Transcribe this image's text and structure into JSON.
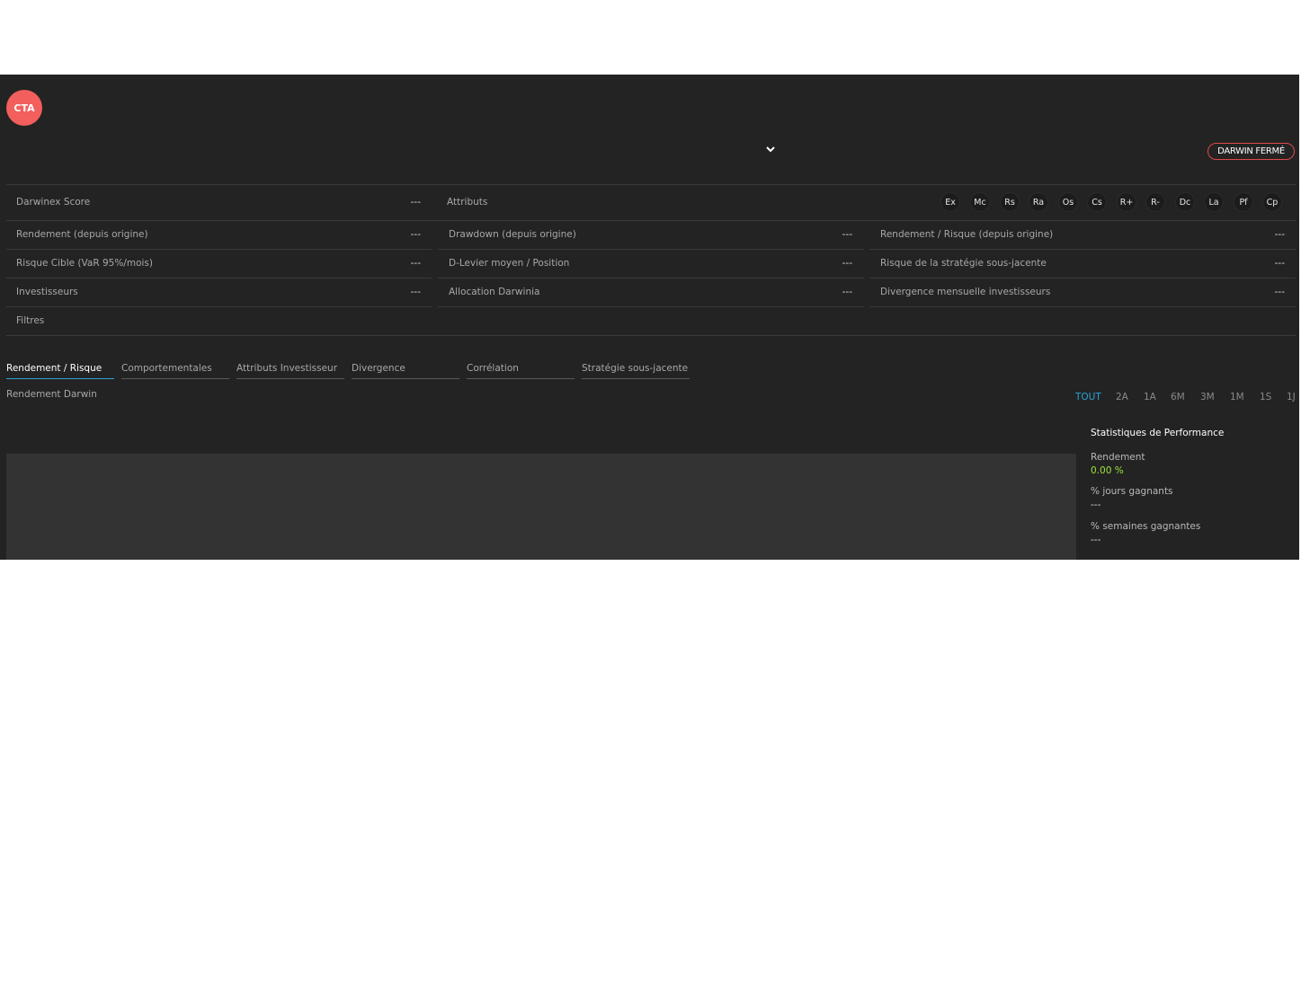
{
  "header": {
    "avatar_text": "CTA",
    "status_badge": "DARWIN FERMÉ",
    "accent_color": "#f25f5c"
  },
  "score_row": {
    "label": "Darwinex Score",
    "value": "---",
    "attributes_label": "Attributs",
    "attributes": [
      "Ex",
      "Mc",
      "Rs",
      "Ra",
      "Os",
      "Cs",
      "R+",
      "R-",
      "Dc",
      "La",
      "Pf",
      "Cp"
    ]
  },
  "metrics": {
    "col1": [
      {
        "label": "Rendement (depuis origine)",
        "value": "---"
      },
      {
        "label": "Risque Cible (VaR 95%/mois)",
        "value": "---"
      },
      {
        "label": "Investisseurs",
        "value": "---"
      }
    ],
    "col2": [
      {
        "label": "Drawdown (depuis origine)",
        "value": "---"
      },
      {
        "label": "D-Levier moyen / Position",
        "value": "---"
      },
      {
        "label": "Allocation Darwinia",
        "value": "---"
      }
    ],
    "col3": [
      {
        "label": "Rendement / Risque (depuis origine)",
        "value": "---"
      },
      {
        "label": "Risque de la stratégie sous-jacente",
        "value": "---"
      },
      {
        "label": "Divergence mensuelle investisseurs",
        "value": "---"
      }
    ]
  },
  "filters_label": "Filtres",
  "tabs": [
    {
      "label": "Rendement / Risque",
      "active": true
    },
    {
      "label": "Comportementales",
      "active": false
    },
    {
      "label": "Attributs Investisseur",
      "active": false
    },
    {
      "label": "Divergence",
      "active": false
    },
    {
      "label": "Corrélation",
      "active": false
    },
    {
      "label": "Stratégie sous-jacente",
      "active": false
    }
  ],
  "chart": {
    "title": "Rendement Darwin",
    "ranges": [
      "TOUT",
      "2A",
      "1A",
      "6M",
      "3M",
      "1M",
      "1S",
      "1J"
    ],
    "active_range": "TOUT"
  },
  "stats": {
    "title": "Statistiques de Performance",
    "items": [
      {
        "label": "Rendement",
        "value": "0.00 %"
      },
      {
        "label": "% jours gagnants",
        "value": "---"
      },
      {
        "label": "% semaines gagnantes",
        "value": "---"
      }
    ],
    "positive_color": "#9be33a"
  }
}
